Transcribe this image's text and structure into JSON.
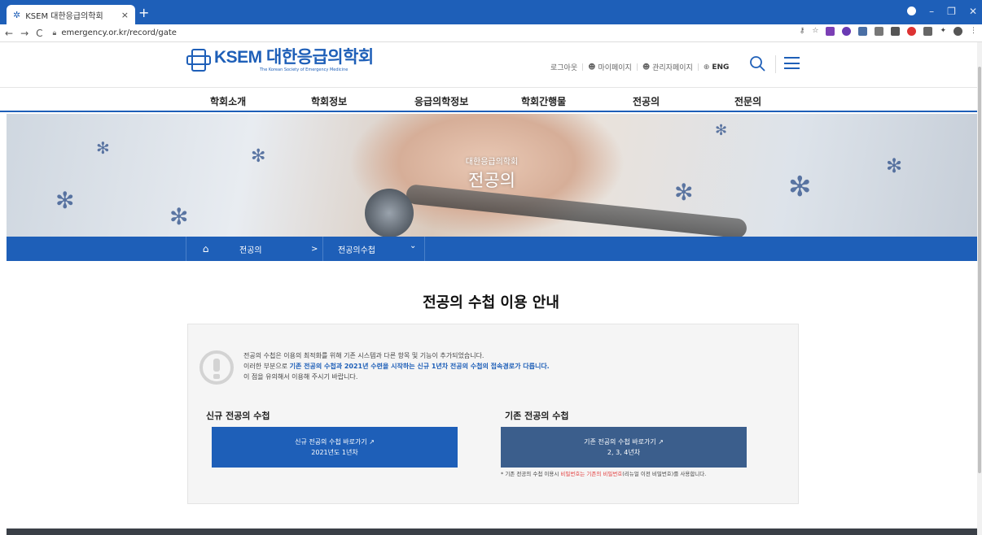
{
  "browser": {
    "tab_title": "KSEM 대한응급의학회",
    "tab_close": "×",
    "new_tab": "+",
    "url": "emergency.or.kr/record/gate"
  },
  "header": {
    "logo_main": "KSEM 대한응급의학회",
    "logo_sub": "The Korean Society of Emergency Medicine",
    "util": [
      "로그아웃",
      "마이페이지",
      "관리자페이지",
      "ENG"
    ]
  },
  "gnb": [
    "학회소개",
    "학회정보",
    "응급의학정보",
    "학회간행물",
    "전공의",
    "전문의"
  ],
  "hero": {
    "subtitle": "대한응급의학회",
    "title": "전공의"
  },
  "location": {
    "level1": "전공의",
    "sep": ">",
    "level2": "전공의수첩",
    "chevron": "⌄"
  },
  "main": {
    "page_title": "전공의 수첩 이용 안내",
    "notice": {
      "line1": "전공의 수첩은 이용의 최적화를 위해 기존 시스템과 다른 항목 및 기능이 추가되었습니다.",
      "line2_prefix": "이러한 부분으로 ",
      "line2_bold": "기존 전공의 수첩과 2021년 수련을 시작하는 신규 1년차 전공의 수첩의 접속경로가 다릅니다.",
      "line3": "이 점을 유의해서 이용해 주시기 바랍니다."
    },
    "new": {
      "heading": "신규 전공의 수첩",
      "button_line1": "신규 전공의 수첩 바로가기 ↗",
      "button_line2": "2021년도 1년차"
    },
    "old": {
      "heading": "기존 전공의 수첩",
      "button_line1": "기존 전공의 수첩 바로가기 ↗",
      "button_line2": "2, 3, 4년차",
      "note_prefix": "* 기존 전공의 수첩 이용시 ",
      "note_red": "비밀번호는 기존의 비밀번호",
      "note_suffix": "(리뉴얼 이전 비밀번호)를 사용합니다."
    }
  },
  "colors": {
    "primary": "#1e5fb8",
    "secondary": "#3b5e8c",
    "warning": "#e23b3b"
  }
}
